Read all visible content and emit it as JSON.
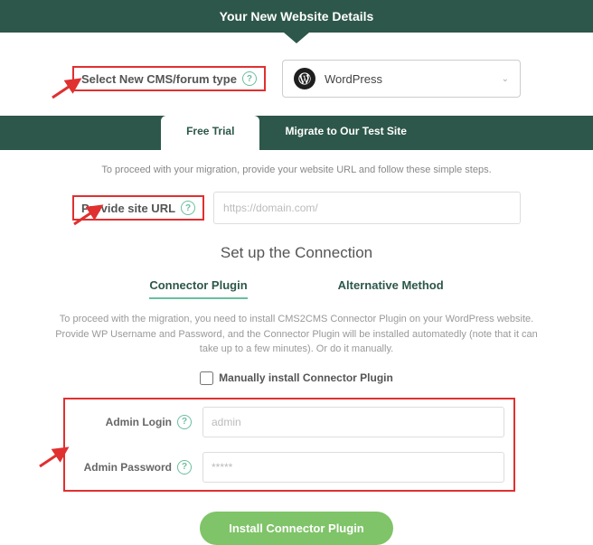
{
  "header": {
    "title": "Your New Website Details"
  },
  "cms": {
    "label": "Select New CMS/forum type",
    "selected": "WordPress"
  },
  "tabs": {
    "free_trial": "Free Trial",
    "migrate": "Migrate to Our Test Site"
  },
  "instruction": "To proceed with your migration, provide your website URL and follow these simple steps.",
  "url": {
    "label": "Provide site URL",
    "placeholder": "https://domain.com/"
  },
  "setup_title": "Set up the Connection",
  "subtabs": {
    "connector": "Connector Plugin",
    "alternative": "Alternative Method"
  },
  "description": "To proceed with the migration, you need to install CMS2CMS Connector Plugin on your WordPress website. Provide WP Username and Password, and the Connector Plugin will be installed automatedly (note that it can take up to a few minutes). Or do it manually.",
  "manual": {
    "label": "Manually install Connector Plugin"
  },
  "creds": {
    "login_label": "Admin Login",
    "login_placeholder": "admin",
    "password_label": "Admin Password",
    "password_placeholder": "*****"
  },
  "install_label": "Install Connector Plugin"
}
